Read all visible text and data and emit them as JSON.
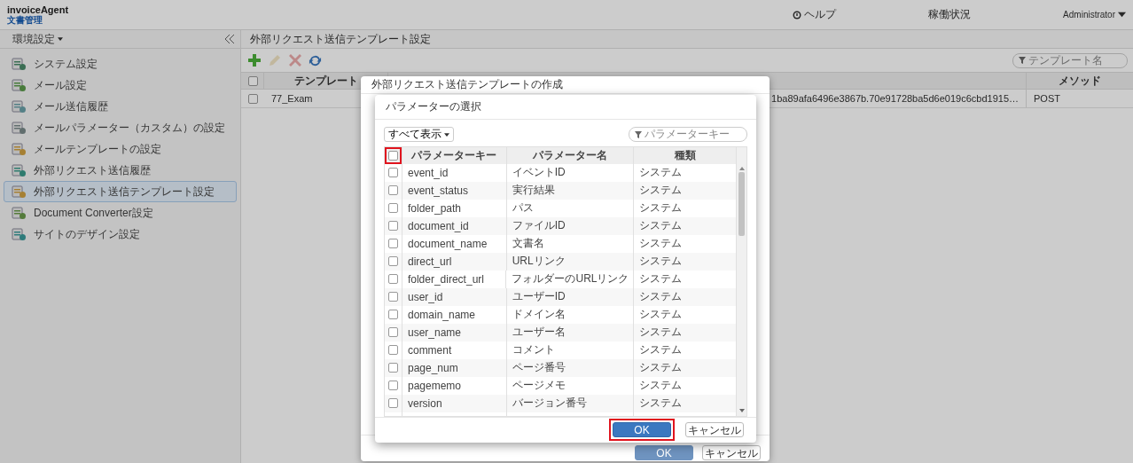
{
  "header": {
    "logo": "invoiceAgent",
    "subtitle": "文書管理",
    "links": [
      {
        "kind": "help",
        "label": "ヘルプ"
      },
      {
        "kind": "plain",
        "label": "稼働状況"
      }
    ],
    "user": "Administrator"
  },
  "sidebar": {
    "title": "環境設定",
    "items": [
      {
        "kind": "system",
        "label": "システム設定",
        "selected": false
      },
      {
        "kind": "mail",
        "label": "メール設定",
        "selected": false
      },
      {
        "kind": "mailhistory",
        "label": "メール送信履歴",
        "selected": false
      },
      {
        "kind": "mailparam",
        "label": "メールパラメーター（カスタム）の設定",
        "selected": false
      },
      {
        "kind": "mailtemplate",
        "label": "メールテンプレートの設定",
        "selected": false
      },
      {
        "kind": "requesthistory",
        "label": "外部リクエスト送信履歴",
        "selected": false
      },
      {
        "kind": "requesttemplate",
        "label": "外部リクエスト送信テンプレート設定",
        "selected": true
      },
      {
        "kind": "converter",
        "label": "Document Converter設定",
        "selected": false
      },
      {
        "kind": "design",
        "label": "サイトのデザイン設定",
        "selected": false
      }
    ]
  },
  "main": {
    "title": "外部リクエスト送信テンプレート設定",
    "toolbar": [
      {
        "kind": "add",
        "disabled": false
      },
      {
        "kind": "edit",
        "disabled": true
      },
      {
        "kind": "delete",
        "disabled": true
      },
      {
        "kind": "refresh",
        "disabled": false
      }
    ],
    "filter": {
      "placeholder": "テンプレート名"
    },
    "table": {
      "header_checked": false,
      "columns": {
        "name": "テンプレート",
        "method": "メソッド"
      },
      "rows": [
        {
          "checked": false,
          "name": "77_Exam",
          "url": "1ba89afa6496e3867b.70e91728ba5d6e019c6cbd1915…",
          "method": "POST"
        }
      ]
    }
  },
  "create_dialog": {
    "title": "外部リクエスト送信テンプレートの作成",
    "buttons": [
      {
        "kind": "primary",
        "label": "OK",
        "disabled": true
      },
      {
        "kind": "secondary",
        "label": "キャンセル",
        "disabled": false
      }
    ]
  },
  "parameter_dialog": {
    "title": "パラメーターの選択",
    "view": "すべて表示",
    "filter": {
      "placeholder": "パラメーターキー"
    },
    "header_checkbox": {
      "checked": false,
      "highlighted": true
    },
    "columns": [
      "パラメーターキー",
      "パラメーター名",
      "種類"
    ],
    "rows": [
      {
        "checked": false,
        "key": "event_id",
        "name": "イベントID",
        "type": "システム"
      },
      {
        "checked": false,
        "key": "event_status",
        "name": "実行結果",
        "type": "システム"
      },
      {
        "checked": false,
        "key": "folder_path",
        "name": "パス",
        "type": "システム"
      },
      {
        "checked": false,
        "key": "document_id",
        "name": "ファイルID",
        "type": "システム"
      },
      {
        "checked": false,
        "key": "document_name",
        "name": "文書名",
        "type": "システム"
      },
      {
        "checked": false,
        "key": "direct_url",
        "name": "URLリンク",
        "type": "システム"
      },
      {
        "checked": false,
        "key": "folder_direct_url",
        "name": "フォルダーのURLリンク",
        "type": "システム"
      },
      {
        "checked": false,
        "key": "user_id",
        "name": "ユーザーID",
        "type": "システム"
      },
      {
        "checked": false,
        "key": "domain_name",
        "name": "ドメイン名",
        "type": "システム"
      },
      {
        "checked": false,
        "key": "user_name",
        "name": "ユーザー名",
        "type": "システム"
      },
      {
        "checked": false,
        "key": "comment",
        "name": "コメント",
        "type": "システム"
      },
      {
        "checked": false,
        "key": "page_num",
        "name": "ページ番号",
        "type": "システム"
      },
      {
        "checked": false,
        "key": "pagememo",
        "name": "ページメモ",
        "type": "システム"
      },
      {
        "checked": false,
        "key": "version",
        "name": "バージョン番号",
        "type": "システム"
      }
    ],
    "buttons": [
      {
        "kind": "primary",
        "label": "OK",
        "highlighted": true
      },
      {
        "kind": "secondary",
        "label": "キャンセル",
        "highlighted": false
      }
    ]
  }
}
